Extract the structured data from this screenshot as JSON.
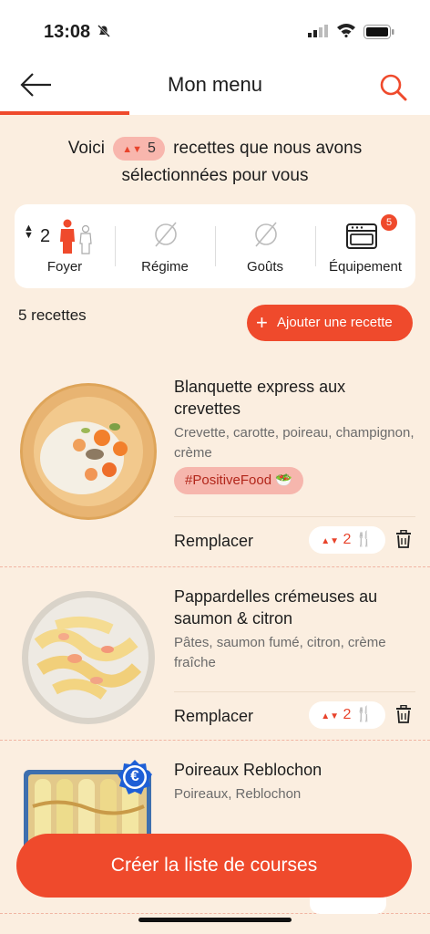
{
  "status_bar": {
    "time": "13:08"
  },
  "header": {
    "title": "Mon menu"
  },
  "intro": {
    "prefix": "Voici",
    "count": "5",
    "suffix": "recettes que nous avons",
    "line2": "sélectionnées pour vous"
  },
  "preferences": {
    "household_count": "2",
    "household_label": "Foyer",
    "diet_label": "Régime",
    "tastes_label": "Goûts",
    "equipment_label": "Équipement",
    "equipment_badge": "5"
  },
  "list": {
    "count_label": "5 recettes",
    "add_button": "Ajouter une recette"
  },
  "recipes": [
    {
      "title": "Blanquette express aux crevettes",
      "ingredients": "Crevette, carotte, poireau, champignon, crème",
      "tag": "#PositiveFood 🥗",
      "replace": "Remplacer",
      "servings": "2"
    },
    {
      "title": "Pappardelles crémeuses au saumon & citron",
      "ingredients": "Pâtes, saumon fumé, citron, crème fraîche",
      "replace": "Remplacer",
      "servings": "2"
    },
    {
      "title": "Poireaux Reblochon",
      "ingredients": "Poireaux, Reblochon",
      "badge": "€"
    }
  ],
  "cta": {
    "label": "Créer la liste de courses"
  },
  "colors": {
    "accent": "#ef4a2c",
    "background": "#fbeee0",
    "tag_bg": "#f6b6ad"
  }
}
